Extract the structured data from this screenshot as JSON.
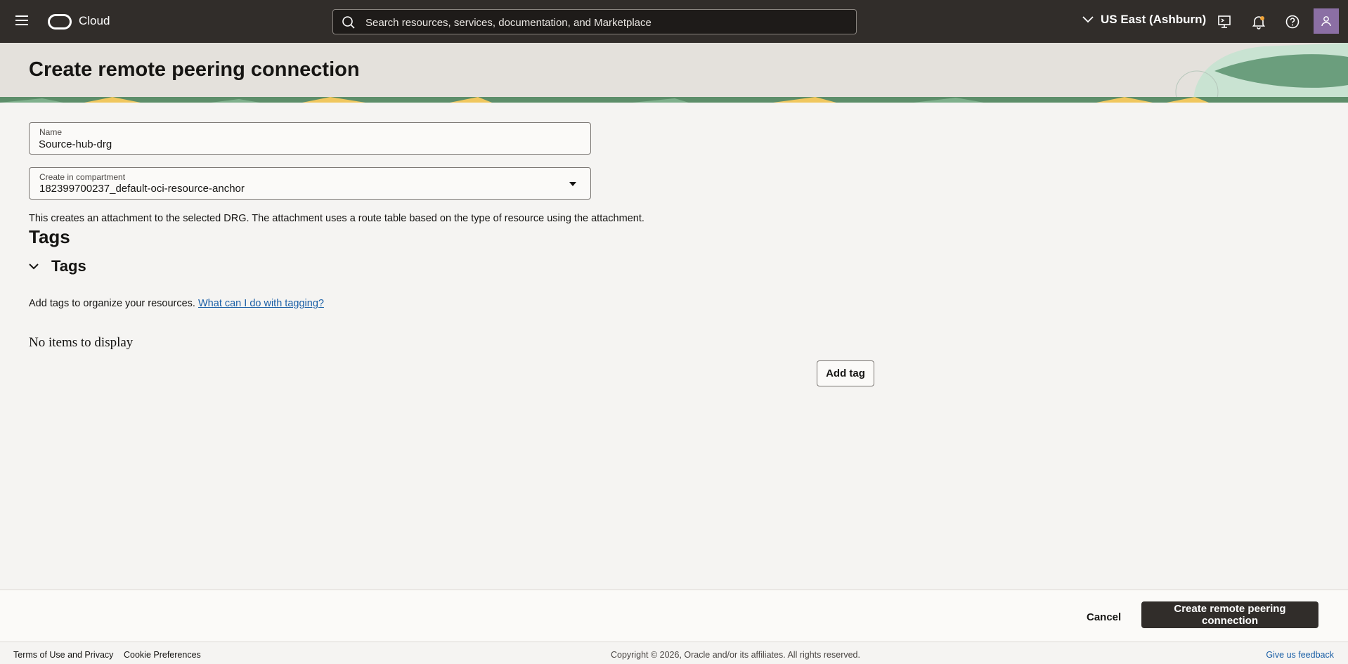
{
  "topbar": {
    "brand": "Cloud",
    "search_placeholder": "Search resources, services, documentation, and Marketplace",
    "region": "US East (Ashburn)",
    "icons": [
      "menu-icon",
      "oracle-logo",
      "search-icon",
      "chevron-down-icon",
      "cloud-shell-icon",
      "bell-icon",
      "help-icon",
      "user-icon"
    ],
    "colors": {
      "bar": "#312d2a",
      "avatar": "#8b6fa4"
    }
  },
  "header": {
    "title": "Create remote peering connection"
  },
  "form": {
    "name": {
      "label": "Name",
      "value": "Source-hub-drg"
    },
    "compartment": {
      "label": "Create in compartment",
      "value": "182399700237_default-oci-resource-anchor"
    },
    "description": "This creates an attachment to the selected DRG. The attachment uses a route table based on the type of resource using the attachment."
  },
  "tags": {
    "heading": "Tags",
    "section_title": "Tags",
    "help_text": "Add tags to organize your resources.",
    "help_link": "What can I do with tagging?",
    "empty_text": "No items to display",
    "add_button": "Add tag"
  },
  "actions": {
    "cancel": "Cancel",
    "create": "Create remote peering connection"
  },
  "footer": {
    "terms": "Terms of Use and Privacy",
    "cookies": "Cookie Preferences",
    "copyright": "Copyright © 2026, Oracle and/or its affiliates. All rights reserved.",
    "feedback": "Give us feedback"
  }
}
